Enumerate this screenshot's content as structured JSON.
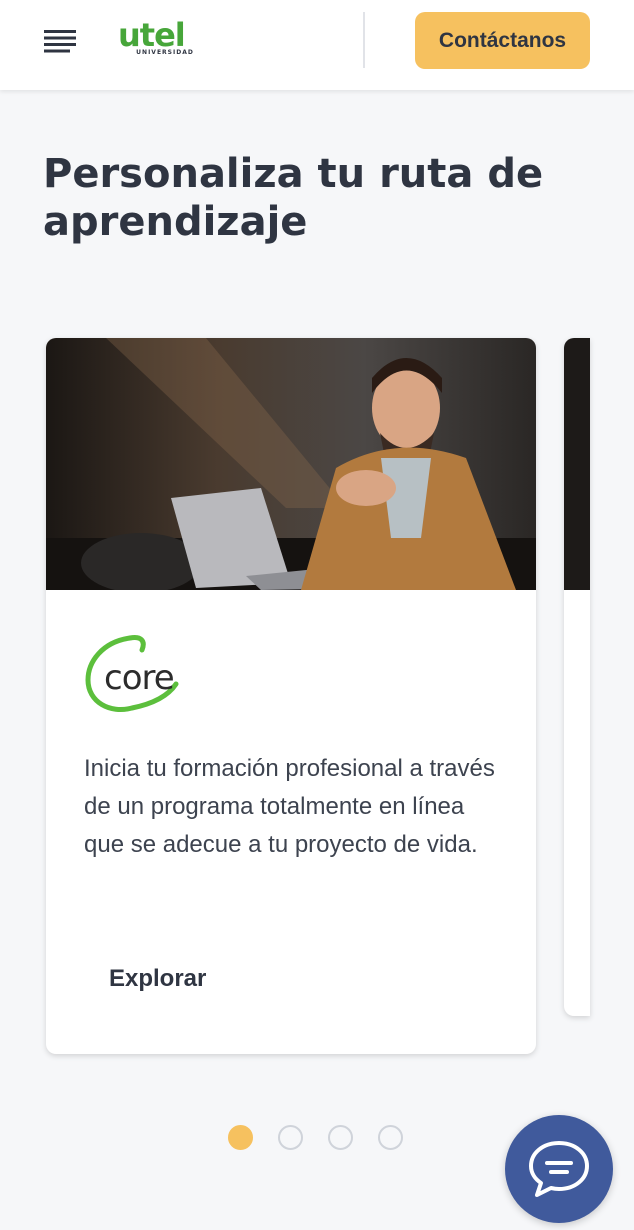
{
  "header": {
    "logo_word": "utel",
    "logo_sub": "UNIVERSIDAD",
    "contact_label": "Contáctanos"
  },
  "page": {
    "title": "Personaliza tu ruta de aprendizaje"
  },
  "carousel": {
    "cards": [
      {
        "brand": "core",
        "description": "Inicia tu formación profesional a través de un programa totalmente en línea que se adecue a tu proyecto de vida.",
        "cta": "Explorar"
      }
    ],
    "total_slides": 4,
    "active_slide": 1
  },
  "colors": {
    "accent": "#f6c15f",
    "brand_green": "#47a63a",
    "chat": "#405a9c",
    "text": "#2f3542"
  },
  "icons": {
    "menu": "hamburger-menu-icon",
    "chat": "chat-bubble-icon"
  }
}
